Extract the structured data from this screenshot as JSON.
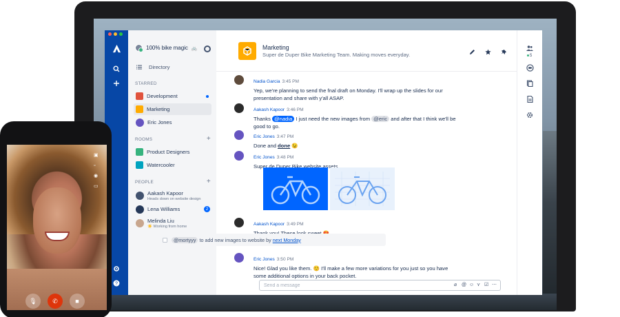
{
  "colors": {
    "rail": "#0747a6",
    "accent": "#0065ff",
    "link": "#0052cc",
    "room_logo": "#ffab00",
    "online": "#36b37e",
    "hangup": "#de350b"
  },
  "app": {
    "rail_icons": [
      "atlassian-logo-icon",
      "search-icon",
      "plus-icon",
      "gear-icon",
      "help-icon"
    ]
  },
  "sidebar": {
    "team_name": "100% bike magic",
    "team_emoji": "🚲",
    "directory_label": "Directory",
    "starred_header": "STARRED",
    "starred": [
      {
        "label": "Development",
        "color": "#e0533d",
        "unread": true
      },
      {
        "label": "Marketing",
        "color": "#ffab00",
        "active": true
      },
      {
        "label": "Eric Jones",
        "avatar_color": "#6554c0"
      }
    ],
    "rooms_header": "ROOMS",
    "rooms": [
      {
        "label": "Product Designers",
        "color": "#36b37e"
      },
      {
        "label": "Watercooler",
        "color": "#00a3bf"
      }
    ],
    "people_header": "PEOPLE",
    "people": [
      {
        "name": "Aakash Kapoor",
        "status": "Heads down on website design",
        "avatar_color": "#42526e"
      },
      {
        "name": "Lena Williams",
        "status": "",
        "avatar_color": "#253858",
        "count": "2"
      },
      {
        "name": "Melinda Liu",
        "status": "☀️ Working from home",
        "avatar_color": "#c8a68e"
      }
    ]
  },
  "room": {
    "title": "Marketing",
    "description": "Super de Duper Bike Marketing Team. Making moves everyday."
  },
  "messages": [
    {
      "author": "Nadia Garcia",
      "time": "3:45 PM",
      "text": "Yep, we're planning to send the fnal draft on Monday. I'll wrap up the slides for our presentation and share with y'all ASAP.",
      "avatar_color": "#5e4b3c"
    },
    {
      "author": "Aakash Kapoor",
      "time": "3:46 PM",
      "pre": "Thanks ",
      "mention": "@nadia",
      "mid": " I just need the new images from ",
      "mention2": "@eric",
      "post": " and after that I think we'll be good to go.",
      "avatar_color": "#2b2b2b"
    },
    {
      "author": "Eric Jones",
      "time": "3:47 PM",
      "pre": "Done and ",
      "bold": "done",
      "post": " 😉",
      "avatar_color": "#6554c0"
    },
    {
      "author": "Eric Jones",
      "time": "3:48 PM",
      "text": "Super de Duper Bike website assets",
      "avatar_color": "#6554c0"
    },
    {
      "author": "Aakash Kapoor",
      "time": "3:49 PM",
      "text": "Thank you! These look sweet 😍",
      "avatar_color": "#2b2b2b"
    },
    {
      "author": "Eric Jones",
      "time": "3:50 PM",
      "text": "Nice! Glad you like them. ☺️ I'll make a few more variations for you just so you have some additional options in your back pocket.",
      "avatar_color": "#6554c0"
    }
  ],
  "task": {
    "mention": "@mortyyy",
    "text": " to add new images to website by ",
    "link": "next Monday"
  },
  "composer": {
    "placeholder": "Send a message"
  },
  "right_rail": {
    "people_count": "5"
  }
}
